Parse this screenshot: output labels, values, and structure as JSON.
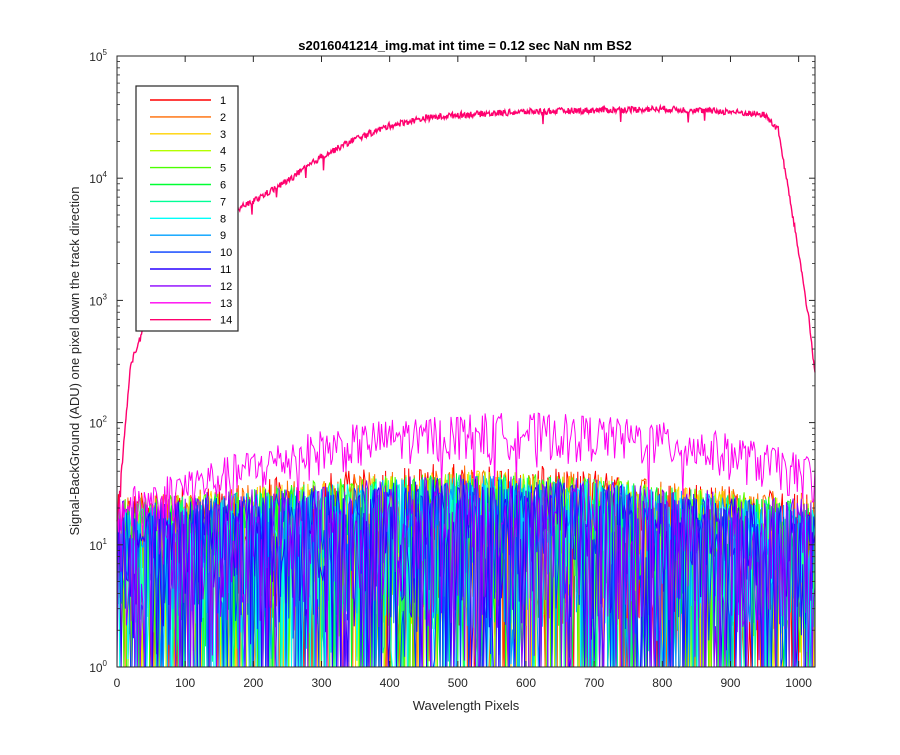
{
  "chart_data": {
    "type": "line",
    "title": "s2016041214_img.mat int time = 0.12 sec  NaN nm BS2",
    "xlabel": "Wavelength Pixels",
    "ylabel": "Signal-BackGround (ADU) one pixel down the track direction",
    "xlim": [
      0,
      1024
    ],
    "ylim": [
      1,
      100000
    ],
    "yscale": "log",
    "grid": false,
    "legend_position": "top-left",
    "x_ticks": [
      "0",
      "100",
      "200",
      "300",
      "400",
      "500",
      "600",
      "700",
      "800",
      "900",
      "1000"
    ],
    "y_tick_exponents": [
      "0",
      "1",
      "2",
      "3",
      "4",
      "5"
    ],
    "y_tick_base": "10",
    "series": [
      {
        "name": "1",
        "color": "#ff0000",
        "profile": "noise",
        "envelope": [
          [
            0,
            20
          ],
          [
            300,
            30
          ],
          [
            500,
            38
          ],
          [
            700,
            32
          ],
          [
            1024,
            20
          ]
        ]
      },
      {
        "name": "2",
        "color": "#ff6a00",
        "profile": "noise",
        "envelope": [
          [
            0,
            20
          ],
          [
            300,
            28
          ],
          [
            500,
            35
          ],
          [
            700,
            30
          ],
          [
            1024,
            20
          ]
        ]
      },
      {
        "name": "3",
        "color": "#ffd200",
        "profile": "noise",
        "envelope": [
          [
            0,
            18
          ],
          [
            300,
            26
          ],
          [
            500,
            32
          ],
          [
            700,
            28
          ],
          [
            1024,
            18
          ]
        ]
      },
      {
        "name": "4",
        "color": "#b4ff00",
        "profile": "noise",
        "envelope": [
          [
            0,
            18
          ],
          [
            300,
            26
          ],
          [
            500,
            32
          ],
          [
            700,
            28
          ],
          [
            1024,
            18
          ]
        ]
      },
      {
        "name": "5",
        "color": "#4cff00",
        "profile": "noise",
        "envelope": [
          [
            0,
            18
          ],
          [
            300,
            26
          ],
          [
            500,
            32
          ],
          [
            700,
            28
          ],
          [
            1024,
            18
          ]
        ]
      },
      {
        "name": "6",
        "color": "#00ff32",
        "profile": "noise",
        "envelope": [
          [
            0,
            17
          ],
          [
            300,
            25
          ],
          [
            500,
            30
          ],
          [
            700,
            27
          ],
          [
            1024,
            17
          ]
        ]
      },
      {
        "name": "7",
        "color": "#00ff96",
        "profile": "noise",
        "envelope": [
          [
            0,
            17
          ],
          [
            300,
            25
          ],
          [
            500,
            30
          ],
          [
            700,
            27
          ],
          [
            1024,
            17
          ]
        ]
      },
      {
        "name": "8",
        "color": "#00fffa",
        "profile": "noise",
        "envelope": [
          [
            0,
            16
          ],
          [
            300,
            24
          ],
          [
            500,
            29
          ],
          [
            700,
            26
          ],
          [
            1024,
            16
          ]
        ]
      },
      {
        "name": "9",
        "color": "#00a0ff",
        "profile": "noise",
        "envelope": [
          [
            0,
            16
          ],
          [
            300,
            24
          ],
          [
            500,
            29
          ],
          [
            700,
            26
          ],
          [
            1024,
            16
          ]
        ]
      },
      {
        "name": "10",
        "color": "#003cff",
        "profile": "noise",
        "envelope": [
          [
            0,
            16
          ],
          [
            300,
            23
          ],
          [
            500,
            28
          ],
          [
            700,
            25
          ],
          [
            1024,
            16
          ]
        ]
      },
      {
        "name": "11",
        "color": "#2800ff",
        "profile": "noise",
        "envelope": [
          [
            0,
            16
          ],
          [
            300,
            23
          ],
          [
            500,
            28
          ],
          [
            700,
            25
          ],
          [
            1024,
            16
          ]
        ]
      },
      {
        "name": "12",
        "color": "#8c00ff",
        "profile": "noise",
        "envelope": [
          [
            0,
            18
          ],
          [
            300,
            25
          ],
          [
            500,
            30
          ],
          [
            700,
            27
          ],
          [
            1024,
            18
          ]
        ]
      },
      {
        "name": "13",
        "color": "#ff00f0",
        "profile": "noise",
        "envelope": [
          [
            0,
            20
          ],
          [
            100,
            32
          ],
          [
            200,
            45
          ],
          [
            300,
            65
          ],
          [
            400,
            80
          ],
          [
            500,
            88
          ],
          [
            600,
            90
          ],
          [
            700,
            85
          ],
          [
            800,
            75
          ],
          [
            900,
            60
          ],
          [
            1000,
            42
          ],
          [
            1024,
            40
          ]
        ]
      },
      {
        "name": "14",
        "color": "#ff006e",
        "profile": "signal",
        "envelope": [
          [
            0,
            15
          ],
          [
            20,
            300
          ],
          [
            40,
            600
          ],
          [
            80,
            1500
          ],
          [
            120,
            3500
          ],
          [
            160,
            5000
          ],
          [
            200,
            6500
          ],
          [
            250,
            9500
          ],
          [
            300,
            15000
          ],
          [
            350,
            21000
          ],
          [
            400,
            27000
          ],
          [
            450,
            31000
          ],
          [
            500,
            33000
          ],
          [
            600,
            35000
          ],
          [
            700,
            36000
          ],
          [
            800,
            37000
          ],
          [
            900,
            35000
          ],
          [
            950,
            33000
          ],
          [
            970,
            25000
          ],
          [
            985,
            8000
          ],
          [
            1000,
            2500
          ],
          [
            1015,
            700
          ],
          [
            1024,
            250
          ]
        ]
      }
    ]
  }
}
